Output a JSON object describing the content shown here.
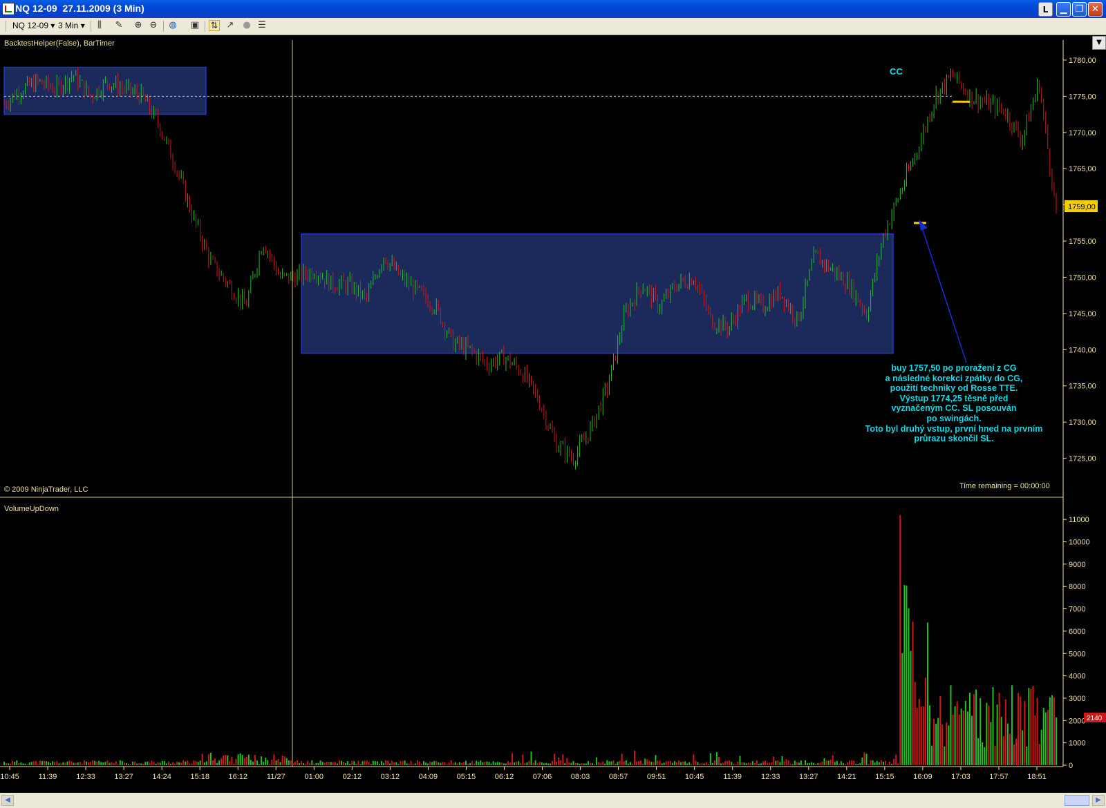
{
  "window": {
    "title": "NQ 12-09  27.11.2009 (3 Min)",
    "buttons": {
      "l": "L",
      "minimize": "▁",
      "restore": "❐",
      "close": "✕"
    }
  },
  "toolbar": {
    "instrument": "NQ 12-09",
    "interval": "3 Min",
    "icons": [
      "bar-style-icon",
      "draw-tool-icon",
      "zoom-in-icon",
      "zoom-out-icon",
      "globe-icon",
      "properties-icon",
      "strategy-icon",
      "indicator-icon",
      "circle-icon",
      "data-box-icon"
    ]
  },
  "price_panel": {
    "indicator_label": "BacktestHelper(False), BarTimer",
    "copyright": "© 2009 NinjaTrader, LLC",
    "time_remaining": "Time remaining = 00:00:00",
    "last_price": "1759,00",
    "cc_label": "CC",
    "note_lines": [
      "buy 1757,50 po proražení z CG",
      "a následné korekci zpátky do CG,",
      "použití techniky od Rosse TTE.",
      "Výstup 1774,25 těsně před",
      "vyznačeným CC. SL posouván",
      "po swingách.",
      "Toto byl druhý vstup, první hned na prvním",
      "průrazu skončil SL."
    ]
  },
  "volume_panel": {
    "indicator_label": "VolumeUpDown",
    "last_volume": "2140"
  },
  "colors": {
    "up": "#21c321",
    "down": "#d01818",
    "box_fill": "#1b2a5a",
    "box_border": "#2034c8",
    "axis": "#f0e0a0",
    "text": "#18d8e6"
  },
  "chart_data": [
    {
      "type": "candlestick",
      "title": "",
      "ylim": [
        1720,
        1782
      ],
      "y_ticks": [
        "1780,00",
        "1775,00",
        "1770,00",
        "1765,00",
        "1760,00",
        "1755,00",
        "1750,00",
        "1745,00",
        "1740,00",
        "1735,00",
        "1730,00",
        "1725,00"
      ],
      "x_ticks": [
        "10:45",
        "11:39",
        "12:33",
        "13:27",
        "14:24",
        "15:18",
        "16:12",
        "11/27",
        "01:00",
        "02:12",
        "03:12",
        "04:09",
        "05:15",
        "06:12",
        "07:06",
        "08:03",
        "08:57",
        "09:51",
        "10:45",
        "11:39",
        "12:33",
        "13:27",
        "14:21",
        "15:15",
        "16:09",
        "17:03",
        "17:57",
        "18:51"
      ],
      "close_path": [
        1774,
        1776,
        1777,
        1776,
        1778,
        1775,
        1777,
        1776,
        1775,
        1771,
        1765,
        1758,
        1752,
        1749,
        1746,
        1755,
        1750,
        1750,
        1751,
        1749,
        1749,
        1747,
        1753,
        1750,
        1748,
        1746,
        1741,
        1740,
        1738,
        1739,
        1737,
        1733,
        1727,
        1725,
        1729,
        1735,
        1745,
        1749,
        1746,
        1749,
        1750,
        1744,
        1743,
        1747,
        1746,
        1748,
        1744,
        1753,
        1751,
        1749,
        1745,
        1756,
        1762,
        1768,
        1775,
        1778,
        1775,
        1774,
        1773,
        1769,
        1777,
        1759
      ],
      "annotations": [
        {
          "type": "box",
          "label": "",
          "ylim": [
            1772.5,
            1779
          ]
        },
        {
          "type": "box",
          "label": "",
          "ylim": [
            1739.5,
            1756
          ]
        },
        {
          "type": "hline",
          "label": "CC",
          "y": 1775
        },
        {
          "type": "marker",
          "label": "buy",
          "y": 1757.5
        },
        {
          "type": "marker",
          "label": "exit",
          "y": 1774.25
        }
      ]
    },
    {
      "type": "bar",
      "title": "",
      "ylim": [
        0,
        11500
      ],
      "y_ticks": [
        "11000",
        "10000",
        "9000",
        "8000",
        "7000",
        "6000",
        "5000",
        "4000",
        "3000",
        "2000",
        "1000",
        "0"
      ],
      "peak_volume": 11200,
      "last_volume": 2140
    }
  ]
}
